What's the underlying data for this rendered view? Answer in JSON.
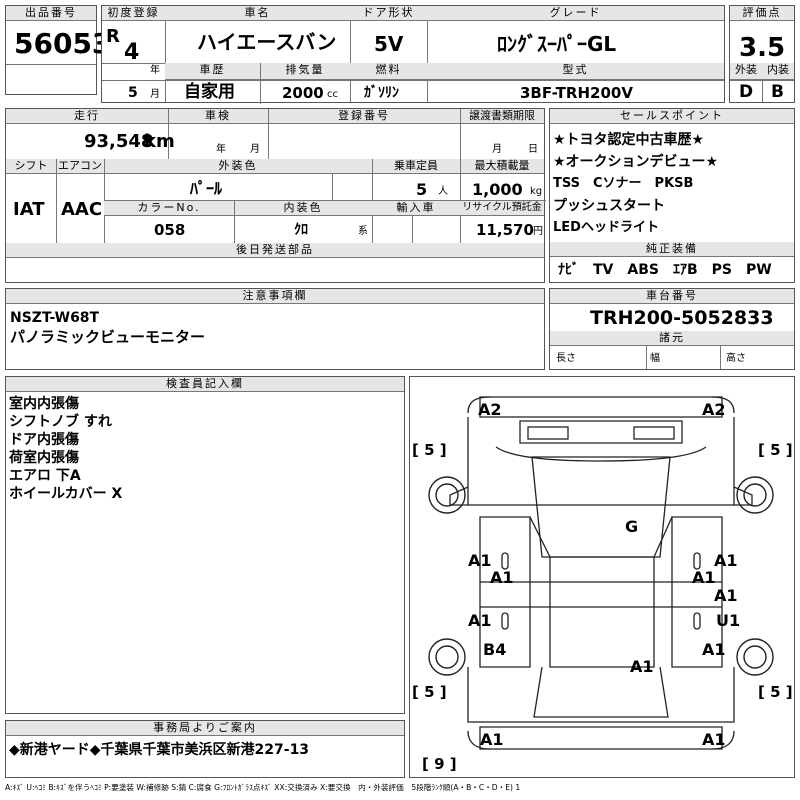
{
  "top": {
    "lot_number_label": "出品番号",
    "lot_number": "56053",
    "first_reg_label": "初度登録",
    "era": "R",
    "reg_year": "4",
    "year_unit": "年",
    "reg_month": "5",
    "month_unit": "月",
    "car_name_label": "車名",
    "car_name": "ハイエースバン",
    "history_label": "車歴",
    "history": "自家用",
    "displacement_label": "排気量",
    "displacement": "2000",
    "displacement_unit": "cc",
    "door_label": "ドア形状",
    "door": "5V",
    "fuel_label": "燃料",
    "fuel": "ｶﾞｿﾘﾝ",
    "grade_label": "グレード",
    "grade": "ﾛﾝｸﾞｽｰﾊﾟｰGL",
    "model_label": "型式",
    "model": "3BF-TRH200V",
    "score_label": "評価点",
    "score": "3.5",
    "exterior_label": "外装",
    "exterior": "D",
    "interior_label": "内装",
    "interior": "B"
  },
  "mid": {
    "mileage_label": "走行",
    "mileage": "93,548",
    "mileage_unit": "km",
    "inspection_label": "車検",
    "inspection_year_unit": "年",
    "inspection_month_unit": "月",
    "reg_no_label": "登録番号",
    "transfer_label": "譲渡書類期限",
    "transfer_month_unit": "月",
    "transfer_day_unit": "日",
    "shift_label": "シフト",
    "shift": "IAT",
    "ac_label": "エアコン",
    "ac": "AAC",
    "ext_color_label": "外装色",
    "ext_color": "ﾊﾟｰﾙ",
    "capacity_label": "乗車定員",
    "capacity": "5",
    "capacity_unit": "人",
    "max_load_label": "最大積載量",
    "max_load": "1,000",
    "max_load_unit": "kg",
    "color_no_label": "カラーNo.",
    "color_no": "058",
    "int_color_label": "内装色",
    "int_color": "ｸﾛ",
    "int_color_unit": "系",
    "import_label": "輸入車",
    "recycle_label": "リサイクル預託金",
    "recycle": "11,570",
    "recycle_unit": "円",
    "later_parts_label": "後日発送部品"
  },
  "sales": {
    "label": "セールスポイント",
    "lines": [
      "★トヨタ認定中古車歴★",
      "★オークションデビュー★",
      "TSS　Cソナー　PKSB",
      "プッシュスタート",
      "LEDヘッドライト"
    ]
  },
  "equip": {
    "label": "純正装備",
    "text": "ﾅﾋﾞ　TV　ABS　ｴｱB　PS　PW"
  },
  "notes": {
    "label": "注意事項欄",
    "lines": [
      "NSZT-W68T",
      "パノラミックビューモニター"
    ]
  },
  "chassis": {
    "label": "車台番号",
    "number": "TRH200-5052833",
    "dims_label": "諸元",
    "length_label": "長さ",
    "width_label": "幅",
    "height_label": "高さ"
  },
  "inspector": {
    "label": "検査員記入欄",
    "lines": [
      "室内内張傷",
      "シフトノブ すれ",
      "ドア内張傷",
      "荷室内張傷",
      "エアロ 下A",
      "ホイールカバー X"
    ]
  },
  "diagram": {
    "marks": {
      "front_left": "A2",
      "front_right": "A2",
      "roof": "G",
      "fl_door_outer": "A1",
      "fl_door_inner": "A1",
      "fr_door_outer": "A1",
      "fr_door_inner": "A1",
      "rl_door": "A1",
      "rr_door_a": "A1",
      "rr_door_u": "U1",
      "rear_left": "B4",
      "rear_right": "A1",
      "rear_center": "A1",
      "bumper_left": "A1",
      "bumper_right": "A1"
    },
    "tyre_marks": {
      "fl": "[ 5 ]",
      "fr": "[ 5 ]",
      "rl": "[ 5 ]",
      "rr": "[ 5 ]",
      "spare": "[ 9 ]"
    }
  },
  "office": {
    "label": "事務局よりご案内",
    "text": "◆新港ヤード◆千葉県千葉市美浜区新港227-13"
  },
  "legend": "A:ｷｽﾞ U:ﾍｺﾐ B:ｷｽﾞを伴うﾍｺﾐ P:要塗装 W:補修跡 S:錆 C:腐食 G:ﾌﾛﾝﾄｶﾞﾗｽ点ｷｽﾞ XX:交換済み X:要交換　内・外装評価　5段階ﾗﾝｸ順(A・B・C・D・E) 1"
}
